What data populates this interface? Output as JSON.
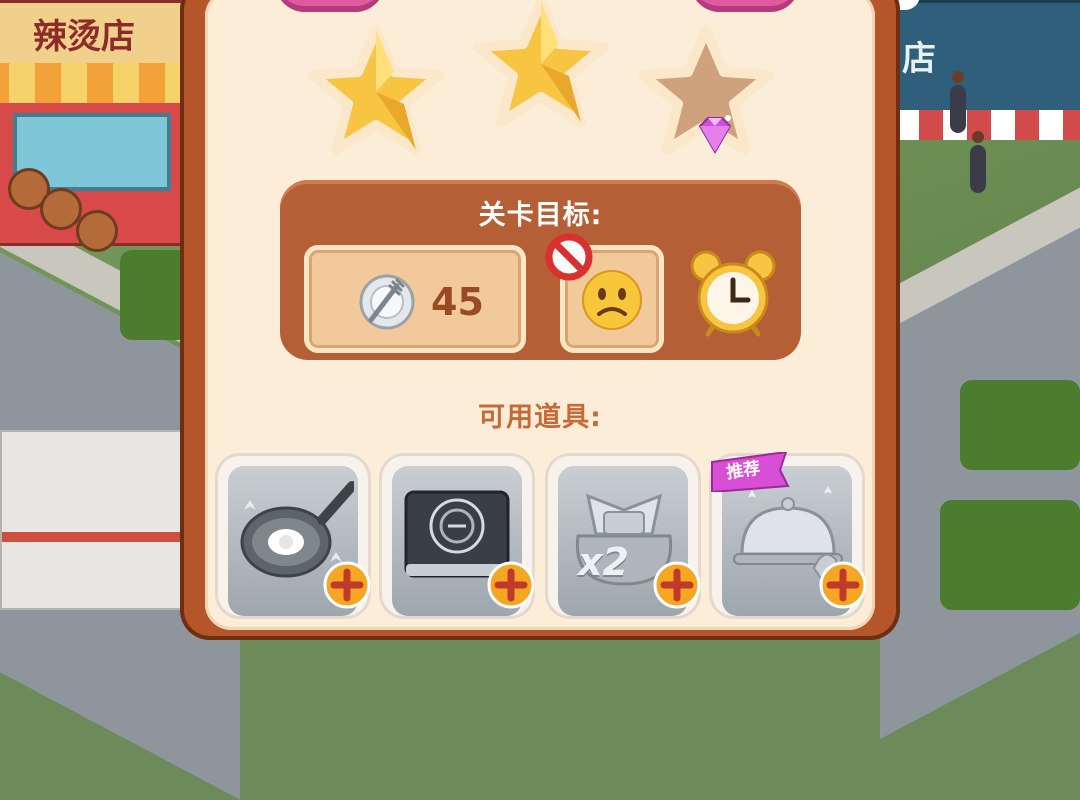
{
  "scene": {
    "shop_left_sign": "辣烫店",
    "shop_right_sign": "店"
  },
  "stars": [
    {
      "state": "earned",
      "icon": "gold-star"
    },
    {
      "state": "earned",
      "icon": "gold-star"
    },
    {
      "state": "empty",
      "icon": "empty-star",
      "extra_icon": "gem-icon"
    }
  ],
  "objectives": {
    "title": "关卡目标:",
    "serve": {
      "icon": "plate-fork-icon",
      "value": "45"
    },
    "no_unhappy": {
      "icon": "sad-face-icon",
      "overlay_icon": "prohibited-icon"
    },
    "time": {
      "icon": "alarm-clock-icon"
    }
  },
  "tools": {
    "title": "可用道具:",
    "items": [
      {
        "name": "frying-pan",
        "icon": "frying-pan-icon",
        "add_label": "+"
      },
      {
        "name": "induction-stove",
        "icon": "induction-stove-icon",
        "add_label": "+"
      },
      {
        "name": "double-coins",
        "icon": "double-coins-icon",
        "badge_text": "x2",
        "add_label": "+"
      },
      {
        "name": "serving-cloche",
        "icon": "cloche-icon",
        "add_label": "+",
        "tag": "推荐"
      }
    ]
  },
  "colors": {
    "panel_border": "#b4552a",
    "panel_bg": "#fbedd8",
    "objective_box": "#b45f35",
    "gold": "#f7c542",
    "plus_button": "#f5a623",
    "recommend_tag": "#d84fd6"
  }
}
